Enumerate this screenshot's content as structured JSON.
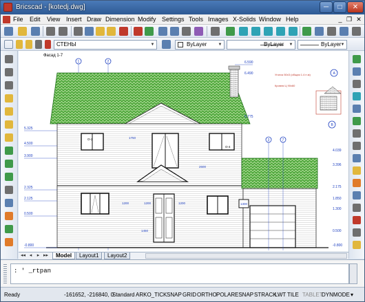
{
  "window": {
    "title": "Bricscad - [kotedj.dwg]",
    "min": "─",
    "max": "□",
    "close": "✕"
  },
  "menu": [
    "File",
    "Edit",
    "View",
    "Insert",
    "Draw",
    "Dimension",
    "Modify",
    "Settings",
    "Tools",
    "Images",
    "X-Solids",
    "Window",
    "Help"
  ],
  "layer_combo": "СТЕНЫ",
  "color_combo": "ByLayer",
  "linetype_combo": "ByLayer",
  "lineweight_combo": "ByLayer",
  "drawing": {
    "sheet_title": "Фасад 1-7",
    "note": "Уголок 50x3 (общая 1.4 п.м)",
    "note2": "Кровля Ц 90х60",
    "levels_left": [
      "5.325",
      "4.500",
      "3.900",
      "2.325",
      "2.125",
      "0.500",
      "-0.800"
    ],
    "levels_right_top": [
      "6.590",
      "6.490",
      "5.775",
      "4.039",
      "3.396",
      "2.175",
      "1.850",
      "1.300",
      "0.500",
      "-0.800"
    ],
    "axes_top": [
      "1",
      "2"
    ],
    "axes_top_right": [
      "A",
      "B"
    ],
    "axis_mid": [
      "3",
      "7"
    ],
    "dims": [
      "1750",
      "1200",
      "1200",
      "1200",
      "2600",
      "2600",
      "1200",
      "1450",
      "1200",
      "2500",
      "1300",
      "1200",
      "1200",
      "750",
      "1300"
    ],
    "window_marks": [
      "О-2",
      "О-2",
      "О-4",
      "О-1",
      "О-1",
      "О-3"
    ]
  },
  "tabs": {
    "nav": [
      "◂◂",
      "◂",
      "▸",
      "▸▸"
    ],
    "items": [
      "Model",
      "Layout1",
      "Layout2"
    ]
  },
  "command": {
    "text": ": ' _rtpan"
  },
  "status": {
    "ready": "Ready",
    "coords": "-161652, -216840, 0",
    "items": [
      "Standard",
      "ARKO_TICK",
      "SNAP",
      "GRID",
      "ORTHO",
      "POLAR",
      "ESNAP",
      "STRACK",
      "LWT",
      "TILE",
      "TABLET",
      "DYNMODE",
      "▾"
    ],
    "off_items": [
      "TABLET"
    ]
  }
}
